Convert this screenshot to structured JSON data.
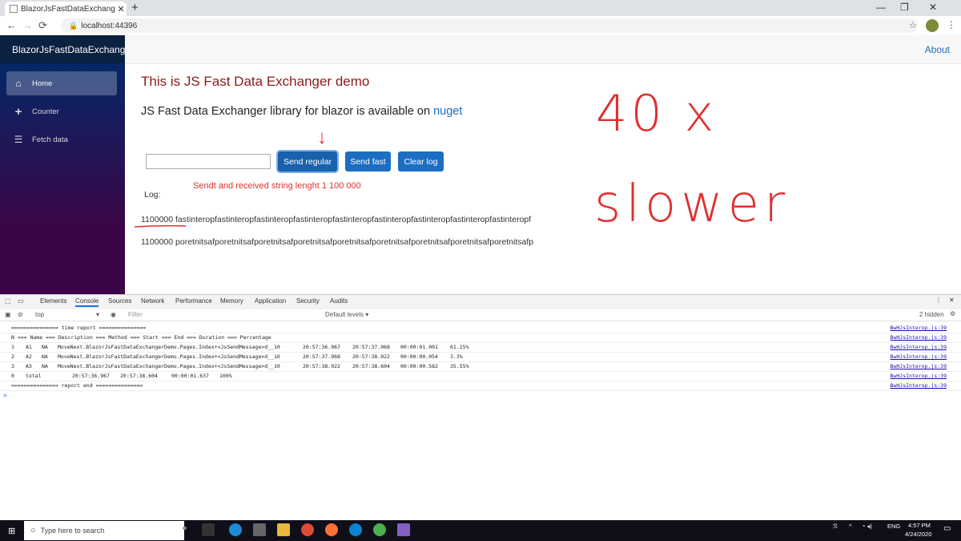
{
  "browser": {
    "tab_title": "BlazorJsFastDataExchangerDemo",
    "tab_close": "✕",
    "new_tab": "+",
    "url": "localhost:44396",
    "win_min": "—",
    "win_max": "❐",
    "win_close": "✕"
  },
  "app": {
    "brand": "BlazorJsFastDataExchanger",
    "about": "About",
    "nav": [
      {
        "label": "Home",
        "icon": "home-icon",
        "active": true
      },
      {
        "label": "Counter",
        "icon": "plus-icon",
        "active": false
      },
      {
        "label": "Fetch data",
        "icon": "list-icon",
        "active": false
      }
    ]
  },
  "main": {
    "heading": "This is JS Fast Data Exchanger demo",
    "lead_text": "JS Fast Data Exchanger library for blazor is available on ",
    "lead_link": "nuget",
    "input_value": "",
    "btn_send_regular": "Send regular",
    "btn_send_fast": "Send fast",
    "btn_clear_log": "Clear log",
    "log_label": "Log:",
    "log_lines": [
      "1100000 fastinteropfastinteropfastinteropfastinteropfastinteropfastinteropfastinteropfastinteropfastinteropf",
      "1100000 poretnitsafporetnitsafporetnitsafporetnitsafporetnitsafporetnitsafporetnitsafporetnitsafporetnitsafp"
    ]
  },
  "annotations": {
    "note": "Sendt and received string lenght 1 100 000",
    "big1": "40 x",
    "big2": "slower",
    "arrow": "↓",
    "color": "#e03030"
  },
  "devtools": {
    "tabs": [
      "Elements",
      "Console",
      "Sources",
      "Network",
      "Performance",
      "Memory",
      "Application",
      "Security",
      "Audits"
    ],
    "active_tab": "Console",
    "context": "top",
    "filter_placeholder": "Filter",
    "levels": "Default levels ▾",
    "hidden": "2 hidden",
    "source": "BwHJsInterop.js:39",
    "rows": [
      {
        "cols": [
          "=============== time report ==============="
        ]
      },
      {
        "cols": [
          "N === Name === Description === Method === Start === End === Duration === Percentage"
        ]
      },
      {
        "cols": [
          "1",
          "A1",
          "NA",
          "MoveNext.BlazorJsFastDataExchangerDemo.Pages.Index+<JsSendMessage>d__10",
          "20:57:36.967",
          "20:57:37.968",
          "00:00:01.001",
          "61.15%"
        ]
      },
      {
        "cols": [
          "2",
          "A2",
          "NA",
          "MoveNext.BlazorJsFastDataExchangerDemo.Pages.Index+<JsSendMessage>d__10",
          "20:57:37.968",
          "20:57:38.022",
          "00:00:00.054",
          "3.3%"
        ]
      },
      {
        "cols": [
          "3",
          "A3",
          "NA",
          "MoveNext.BlazorJsFastDataExchangerDemo.Pages.Index+<JsSendMessage>d__10",
          "20:57:38.022",
          "20:57:38.604",
          "00:00:00.582",
          "35.55%"
        ]
      },
      {
        "cols": [
          "0",
          "total",
          "20:57:36.967",
          "20:57:38.604",
          "00:00:01.637",
          "100%"
        ]
      },
      {
        "cols": [
          "=============== report end ==============="
        ]
      }
    ],
    "prompt": ">"
  },
  "taskbar": {
    "search_placeholder": "Type here to search",
    "lang": "ENG",
    "time": "4:57 PM",
    "date": "4/24/2020"
  }
}
